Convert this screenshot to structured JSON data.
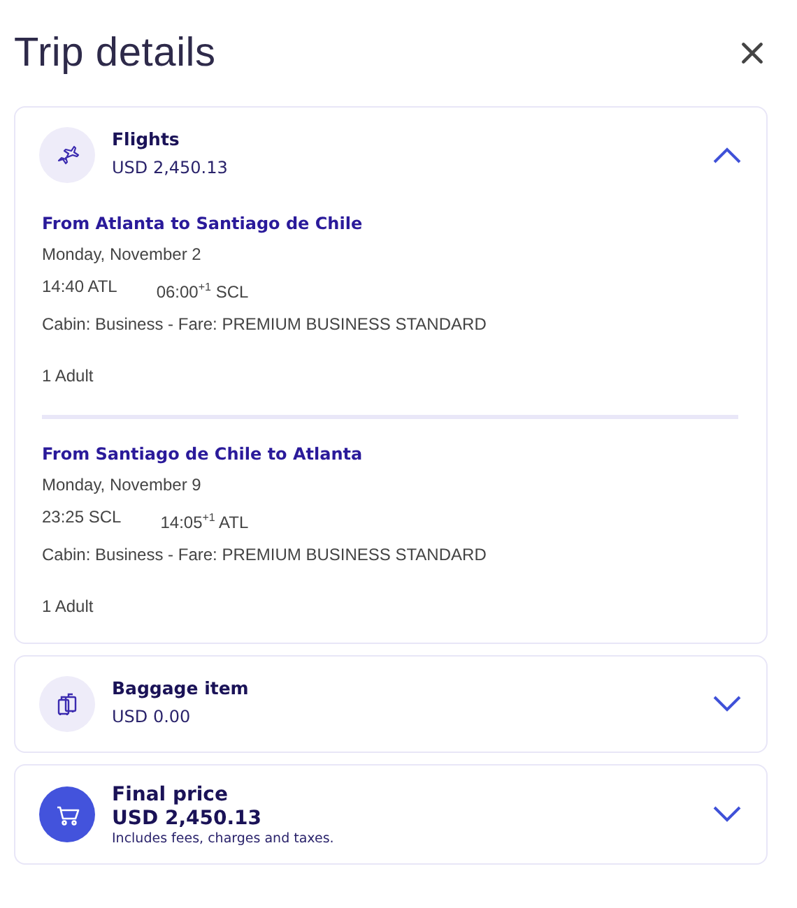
{
  "title": "Trip details",
  "sections": [
    {
      "kind": "flights",
      "title": "Flights",
      "price": "USD 2,450.13",
      "expanded": true,
      "legs": [
        {
          "route": "From Atlanta to Santiago de Chile",
          "date": "Monday, November 2",
          "depart": "14:40 ATL",
          "arrive": "06:00$^{+1}$ SCL",
          "cabin": "Cabin: Business - Fare: PREMIUM BUSINESS STANDARD",
          "passengers": "1 Adult"
        },
        {
          "route": "From Santiago de Chile to Atlanta",
          "date": "Monday, November 9",
          "depart": "23:25 SCL",
          "arrive": "14:05$^{+1}$ ATL",
          "cabin": "Cabin: Business - Fare: PREMIUM BUSINESS STANDARD",
          "passengers": "1 Adult"
        }
      ]
    },
    {
      "kind": "baggage",
      "title": "Baggage item",
      "price": "USD 0.00",
      "expanded": false
    },
    {
      "kind": "total",
      "title": "Final price",
      "price": "USD 2,450.13",
      "note": "Includes fees, charges and taxes.",
      "expanded": false
    }
  ]
}
